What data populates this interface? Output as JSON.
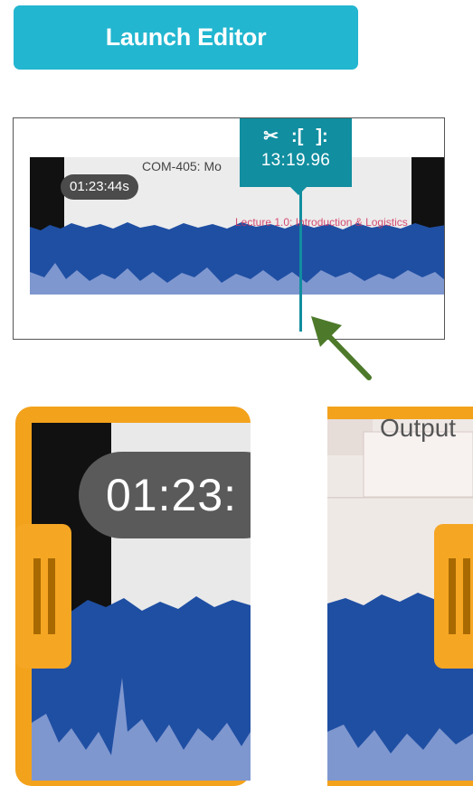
{
  "launch_button": {
    "label": "Launch Editor"
  },
  "clip": {
    "title": "COM-405: Mo",
    "subtitle": "Lecture 1.0: Introduction & Logistics",
    "start_time": "01:23:44s"
  },
  "tooltip": {
    "cut_icon": "scissors-icon",
    "set_in_icon": "set-in-point-icon",
    "set_out_icon": "set-out-point-icon",
    "playhead_time": "13:19.96"
  },
  "zoom": {
    "left_time": "01:23:",
    "right_label": "Output"
  },
  "colors": {
    "accent": "#22b6d0",
    "tooltip": "#118ea0",
    "waveform": "#1f4fa3",
    "waveform_light": "#7f97cf",
    "trim_handle": "#f5a623",
    "arrow": "#4d7a2a"
  }
}
